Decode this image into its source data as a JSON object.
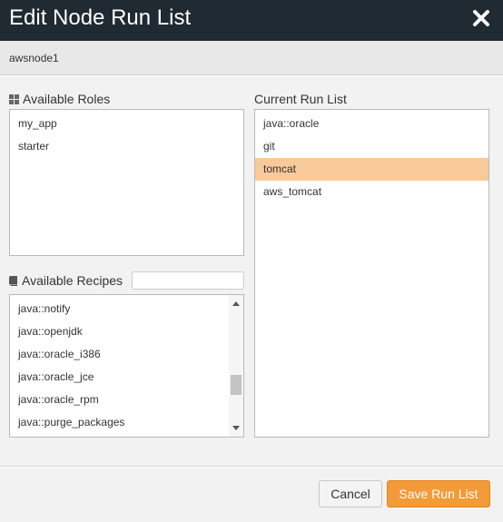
{
  "dialog": {
    "title": "Edit Node Run List",
    "node_name": "awsnode1"
  },
  "roles": {
    "label": "Available Roles",
    "items": [
      "my_app",
      "starter"
    ]
  },
  "recipes": {
    "label": "Available Recipes",
    "search_value": "",
    "items": [
      "java::notify",
      "java::openjdk",
      "java::oracle_i386",
      "java::oracle_jce",
      "java::oracle_rpm",
      "java::purge_packages"
    ]
  },
  "run_list": {
    "label": "Current Run List",
    "items": [
      "java::oracle",
      "git",
      "tomcat",
      "aws_tomcat"
    ],
    "selected_index": 2
  },
  "buttons": {
    "cancel": "Cancel",
    "save": "Save Run List"
  },
  "colors": {
    "title_bar": "#1f2a33",
    "selected_row": "#f8c999",
    "save_button": "#f39a39"
  }
}
